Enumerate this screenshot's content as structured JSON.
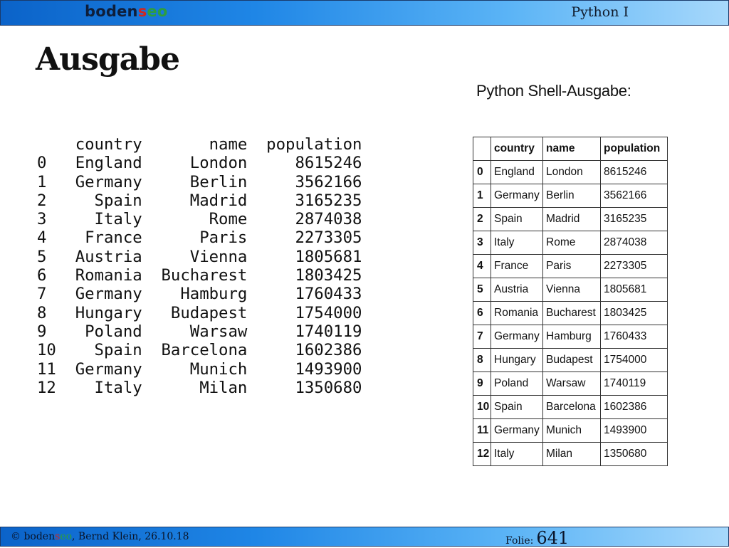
{
  "header": {
    "logo_part1": "boden",
    "logo_part2": "s",
    "logo_part3": "eo",
    "course": "Python I"
  },
  "title": "Ausgabe",
  "console_output": "    country       name  population\n0   England     London     8615246\n1   Germany     Berlin     3562166\n2     Spain     Madrid     3165235\n3     Italy       Rome     2874038\n4    France      Paris     2273305\n5   Austria     Vienna     1805681\n6   Romania  Bucharest     1803425\n7   Germany    Hamburg     1760433\n8   Hungary   Budapest     1754000\n9    Poland     Warsaw     1740119\n10    Spain  Barcelona     1602386\n11  Germany     Munich     1493900\n12    Italy      Milan     1350680",
  "shell_label": "Python Shell-Ausgabe:",
  "table": {
    "columns": [
      "country",
      "name",
      "population"
    ],
    "rows": [
      {
        "index": "0",
        "country": "England",
        "name": "London",
        "population": "8615246"
      },
      {
        "index": "1",
        "country": "Germany",
        "name": "Berlin",
        "population": "3562166"
      },
      {
        "index": "2",
        "country": "Spain",
        "name": "Madrid",
        "population": "3165235"
      },
      {
        "index": "3",
        "country": "Italy",
        "name": "Rome",
        "population": "2874038"
      },
      {
        "index": "4",
        "country": "France",
        "name": "Paris",
        "population": "2273305"
      },
      {
        "index": "5",
        "country": "Austria",
        "name": "Vienna",
        "population": "1805681"
      },
      {
        "index": "6",
        "country": "Romania",
        "name": "Bucharest",
        "population": "1803425"
      },
      {
        "index": "7",
        "country": "Germany",
        "name": "Hamburg",
        "population": "1760433"
      },
      {
        "index": "8",
        "country": "Hungary",
        "name": "Budapest",
        "population": "1754000"
      },
      {
        "index": "9",
        "country": "Poland",
        "name": "Warsaw",
        "population": "1740119"
      },
      {
        "index": "10",
        "country": "Spain",
        "name": "Barcelona",
        "population": "1602386"
      },
      {
        "index": "11",
        "country": "Germany",
        "name": "Munich",
        "population": "1493900"
      },
      {
        "index": "12",
        "country": "Italy",
        "name": "Milan",
        "population": "1350680"
      }
    ]
  },
  "footer": {
    "copyright_prefix": "© boden",
    "brand_s": "s",
    "brand_eo": "eo",
    "author_date": ", Bernd Klein, 26.10.18",
    "slide_label": "Folie:",
    "slide_number": "641"
  },
  "colors": {
    "bar_dark": "#0b63c9",
    "bar_light": "#a7d8fb",
    "logo_red": "#d2261e",
    "logo_green": "#2e9e3e"
  }
}
